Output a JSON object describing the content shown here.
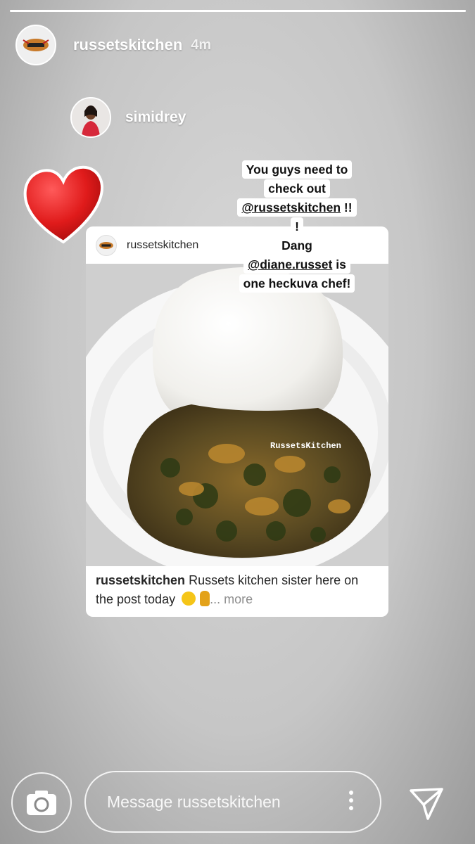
{
  "story": {
    "progress_fraction": 1.0,
    "username": "russetskitchen",
    "timestamp": "4m"
  },
  "mention": {
    "username": "simidrey"
  },
  "caption_lines": {
    "line1": "You guys need to",
    "line2": "check out",
    "line3_handle": "@russetskitchen",
    "line3_suffix": " !!",
    "line4": "!",
    "line5": "Dang",
    "line6_handle": "@diane.russet",
    "line6_suffix": " is",
    "line7": "one heckuva chef!"
  },
  "post": {
    "username": "russetskitchen",
    "watermark": "RussetsKitchen",
    "caption_user": "russetskitchen",
    "caption_text": " Russets kitchen sister here on the post today ",
    "more": "... more"
  },
  "composer": {
    "placeholder": "Message russetskitchen"
  },
  "icons": [
    "camera-icon",
    "more-options-icon",
    "send-icon",
    "heart-sticker"
  ],
  "colors": {
    "heart": "#e01b1b",
    "background": "#c8c8c8"
  }
}
